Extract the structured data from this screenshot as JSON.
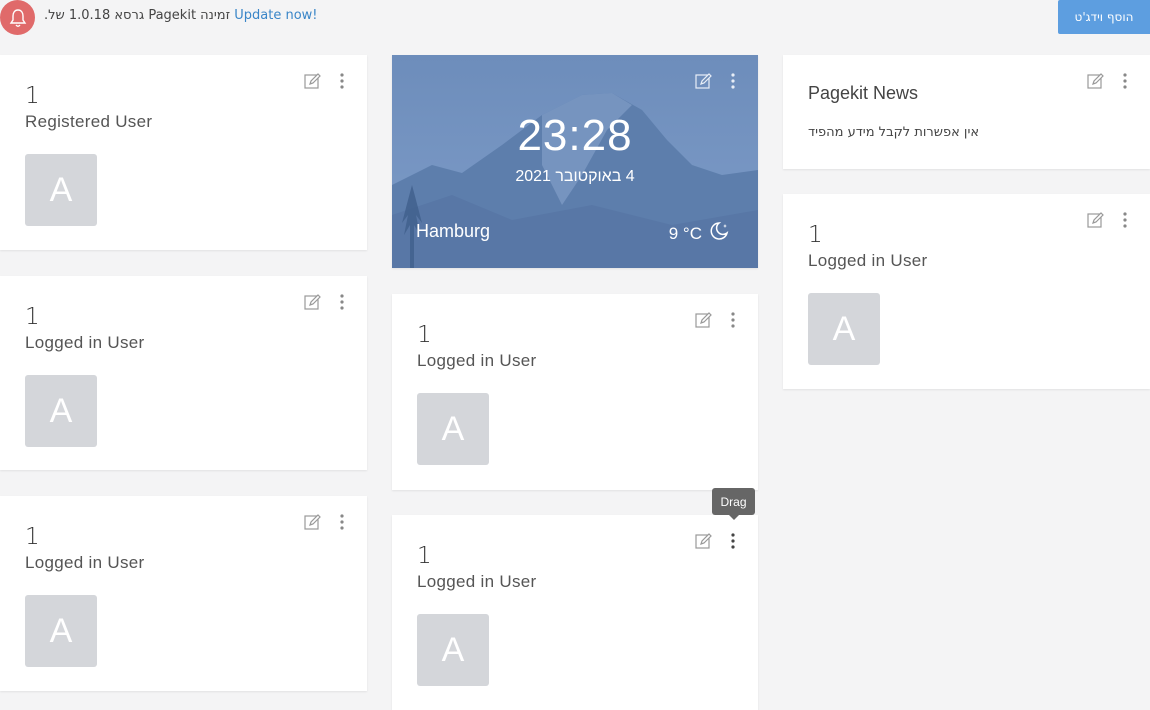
{
  "notification": {
    "text_rtl": "זמינה Pagekit גרסא 1.0.18 של.",
    "link": "Update now!"
  },
  "toolbar": {
    "add_widget_label": "הוסף וידג'ט"
  },
  "widgets": {
    "registered_user": {
      "count": "1",
      "label": "Registered User",
      "avatar": "A"
    },
    "logged_in_user_left_1": {
      "count": "1",
      "label": "Logged in User",
      "avatar": "A"
    },
    "logged_in_user_left_2": {
      "count": "1",
      "label": "Logged in User",
      "avatar": "A"
    },
    "clock": {
      "time": "23:28",
      "date": "4 באוקטובר 2021",
      "city": "Hamburg",
      "temperature": "9 °C",
      "weather_icon": "moon-icon"
    },
    "logged_in_user_mid_1": {
      "count": "1",
      "label": "Logged in User",
      "avatar": "A"
    },
    "logged_in_user_mid_2": {
      "count": "1",
      "label": "Logged in User",
      "avatar": "A"
    },
    "news": {
      "title": "Pagekit News",
      "message": "אין אפשרות לקבל מידע מהפיד"
    },
    "logged_in_user_right": {
      "count": "1",
      "label": "Logged in User",
      "avatar": "A"
    }
  },
  "tooltip": {
    "text": "Drag"
  },
  "colors": {
    "accent": "#5d9ee0",
    "alert": "#e06a6a",
    "link": "#3a86c8",
    "avatar_bg": "#d4d6da"
  }
}
